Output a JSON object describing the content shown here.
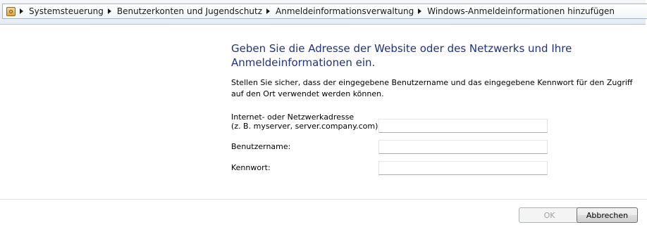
{
  "breadcrumb": {
    "items": [
      "Systemsteuerung",
      "Benutzerkonten und Jugendschutz",
      "Anmeldeinformationsverwaltung",
      "Windows-Anmeldeinformationen hinzufügen"
    ]
  },
  "main": {
    "heading": "Geben Sie die Adresse der Website oder des Netzwerks und Ihre Anmeldeinformationen ein.",
    "instruction": "Stellen Sie sicher, dass der eingegebene Benutzername und das eingegebene Kennwort für den Zugriff auf den Ort verwendet werden können.",
    "fields": {
      "address_label_line1": "Internet- oder Netzwerkadresse",
      "address_label_line2": "(z. B. myserver, server.company.com):",
      "address_value": "",
      "username_label": "Benutzername:",
      "username_value": "",
      "password_label": "Kennwort:",
      "password_value": ""
    }
  },
  "footer": {
    "ok_label": "OK",
    "cancel_label": "Abbrechen"
  }
}
